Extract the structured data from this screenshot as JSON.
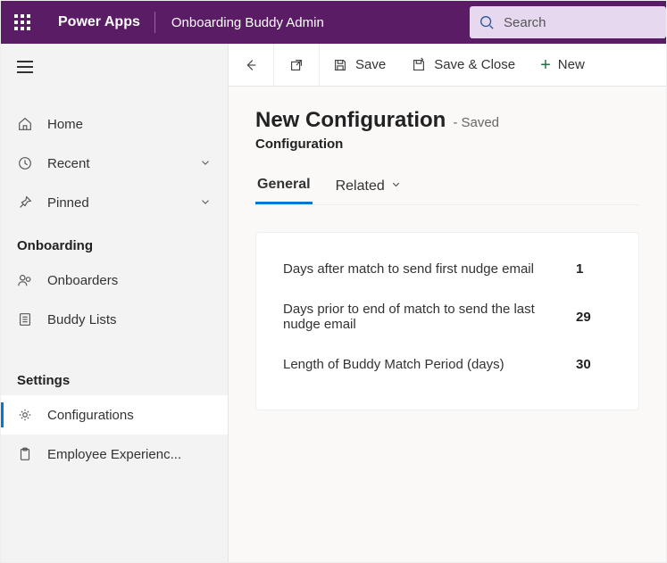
{
  "header": {
    "app_name": "Power Apps",
    "environment": "Onboarding Buddy Admin",
    "search_placeholder": "Search"
  },
  "sidebar": {
    "items": [
      {
        "label": "Home"
      },
      {
        "label": "Recent"
      },
      {
        "label": "Pinned"
      }
    ],
    "sections": {
      "onboarding": {
        "title": "Onboarding",
        "items": [
          {
            "label": "Onboarders"
          },
          {
            "label": "Buddy Lists"
          }
        ]
      },
      "settings": {
        "title": "Settings",
        "items": [
          {
            "label": "Configurations"
          },
          {
            "label": "Employee Experienc..."
          }
        ]
      }
    }
  },
  "commandbar": {
    "save": "Save",
    "save_close": "Save & Close",
    "new": "New"
  },
  "page": {
    "title": "New Configuration",
    "status": "- Saved",
    "entity": "Configuration",
    "tabs": {
      "general": "General",
      "related": "Related"
    },
    "fields": [
      {
        "label": "Days after match to send first nudge email",
        "value": "1"
      },
      {
        "label": "Days prior to end of match to send the last nudge email",
        "value": "29"
      },
      {
        "label": "Length of Buddy Match Period (days)",
        "value": "30"
      }
    ]
  }
}
